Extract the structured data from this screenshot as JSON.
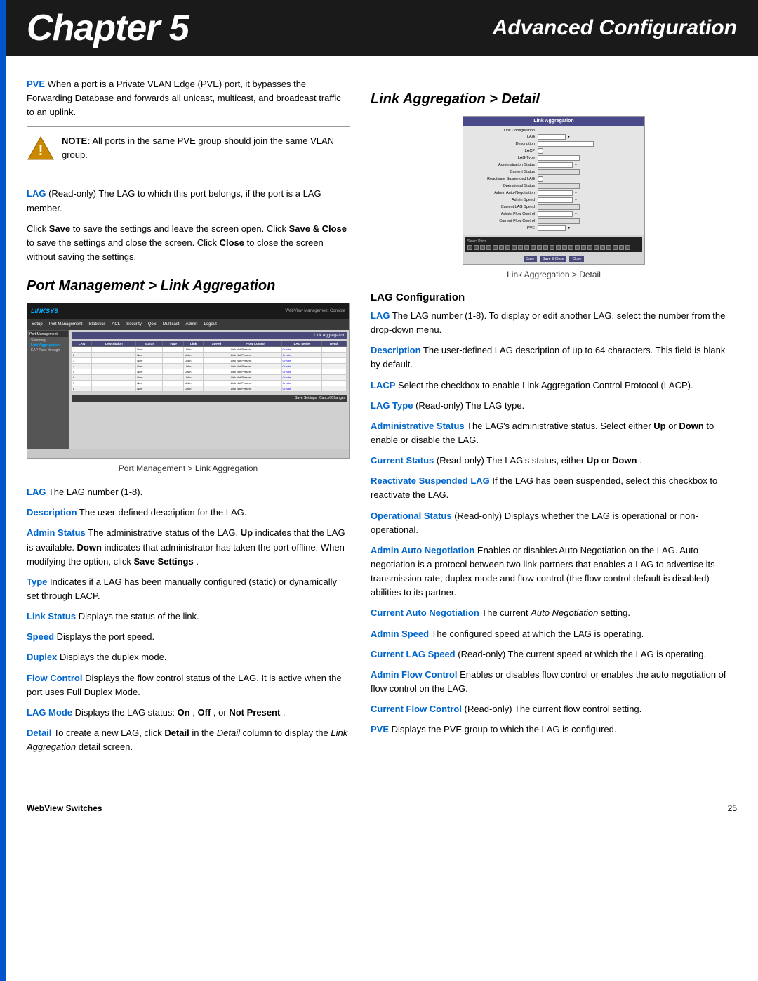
{
  "header": {
    "chapter_label": "Chapter 5",
    "advanced_config": "Advanced Configuration"
  },
  "left_column": {
    "pve_paragraph": "When a port is a Private VLAN Edge (PVE) port, it bypasses the Forwarding Database and forwards all unicast, multicast, and broadcast traffic to an uplink.",
    "pve_term": "PVE",
    "note_label": "NOTE:",
    "note_text": "All ports in the same PVE group should join the same VLAN group.",
    "lag_paragraph": "(Read-only) The LAG to which this port belongs, if the port is a LAG member.",
    "lag_term": "LAG",
    "save_instructions": "Click Save to save the settings and leave the screen open. Click Save & Close to save the settings and close the screen. Click Close to close the screen without saving the settings.",
    "port_mgmt_heading": "Port Management > Link Aggregation",
    "screenshot_caption": "Port Management > Link Aggregation",
    "lag_number": "The LAG number (1-8).",
    "lag_number_term": "LAG",
    "description_term": "Description",
    "description_text": "The user-defined description for the LAG.",
    "admin_status_term": "Admin Status",
    "admin_status_text": "The administrative status of the LAG. Up indicates that the LAG is available. Down indicates that administrator has taken the port offline. When modifying the option, click Save Settings.",
    "up_term": "Up",
    "down_term": "Down",
    "save_settings_term": "Save Settings",
    "type_term": "Type",
    "type_text": "Indicates if a LAG has been manually configured (static) or dynamically set through LACP.",
    "link_status_term": "Link Status",
    "link_status_text": "Displays the status of the link.",
    "speed_term": "Speed",
    "speed_text": "Displays the port speed.",
    "duplex_term": "Duplex",
    "duplex_text": "Displays the duplex mode.",
    "flow_control_term": "Flow Control",
    "flow_control_text": "Displays the flow control status of the LAG. It is active when the port uses Full Duplex Mode.",
    "lag_mode_term": "LAG Mode",
    "lag_mode_text": "Displays the LAG status: On, Off, or Not Present.",
    "on_term": "On",
    "off_term": "Off",
    "not_present_term": "Not Present",
    "detail_term": "Detail",
    "detail_text": "To create a new LAG, click Detail in the Detail column to display the Link Aggregation detail screen.",
    "detail_italic": "Detail",
    "link_aggregation_italic": "Link Aggregation"
  },
  "right_column": {
    "link_agg_heading": "Link Aggregation > Detail",
    "screenshot_caption": "Link Aggregation > Detail",
    "lag_config_heading": "LAG Configuration",
    "lag_config_term": "LAG",
    "lag_config_text": "The LAG number (1-8). To display or edit another LAG, select the number from the drop-down menu.",
    "lag_number_range": "(1-8)",
    "description_term": "Description",
    "description_text": "The user-defined LAG description of up to 64 characters. This field is blank by default.",
    "lacp_term": "LACP",
    "lacp_text": "Select the checkbox to enable Link Aggregation Control Protocol (LACP).",
    "lacp_full": "Link Aggregation Control Protocol (LACP)",
    "lag_type_term": "LAG Type",
    "lag_type_text": "(Read-only) The LAG type.",
    "admin_status_term": "Administrative Status",
    "admin_status_text": "The LAG's administrative status. Select either Up or Down to enable or disable the LAG.",
    "up_term": "Up",
    "down_term": "Down",
    "current_status_term": "Current Status",
    "current_status_text": "(Read-only) The LAG's status, either Up or Down.",
    "up2_term": "Up",
    "down2_term": "Down",
    "reactivate_term": "Reactivate Suspended LAG",
    "reactivate_text": "If the LAG has been suspended, select this checkbox to reactivate the LAG.",
    "operational_term": "Operational Status",
    "operational_text": "(Read-only) Displays whether the LAG is operational or non-operational.",
    "admin_auto_term": "Admin Auto Negotiation",
    "admin_auto_text": "Enables or disables Auto Negotiation on the LAG. Auto-negotiation is a protocol between two link partners that enables a LAG to advertise its transmission rate, duplex mode and flow control (the flow control default is disabled) abilities to its partner.",
    "current_auto_term": "Current Auto Negotiation",
    "current_auto_text": "The current Auto Negotiation setting.",
    "auto_neg_italic": "Auto Negotiation",
    "admin_speed_term": "Admin Speed",
    "admin_speed_text": "The configured speed at which the LAG is operating.",
    "current_lag_speed_term": "Current LAG Speed",
    "current_lag_speed_text": "(Read-only) The current speed at which the LAG is operating.",
    "admin_flow_term": "Admin Flow Control",
    "admin_flow_text": "Enables or disables flow control or enables the auto negotiation of flow control on the LAG.",
    "current_flow_term": "Current Flow Control",
    "current_flow_text": "(Read-only) The current flow control setting.",
    "pve_term": "PVE",
    "pve_text": "Displays the PVE group to which the LAG is configured."
  },
  "footer": {
    "product": "WebView Switches",
    "page_number": "25"
  },
  "mock_table": {
    "headers": [
      "LAG",
      "Description",
      "Status",
      "Type",
      "Link",
      "Speed",
      "Flow Control",
      "LAG Mode",
      "Detail"
    ],
    "rows": [
      [
        "1",
        "",
        "New",
        "",
        "Unknown",
        "",
        "Link Not Present",
        "Create"
      ],
      [
        "2",
        "",
        "New",
        "",
        "Unknown",
        "",
        "Link Not Present",
        "Create"
      ],
      [
        "3",
        "",
        "New",
        "",
        "Unknown",
        "",
        "Link Not Present",
        "Create"
      ],
      [
        "4",
        "",
        "New",
        "",
        "Unknown",
        "",
        "Link Not Present",
        "Create"
      ],
      [
        "5",
        "",
        "New",
        "",
        "Unknown",
        "",
        "Link Not Present",
        "Create"
      ],
      [
        "6",
        "",
        "New",
        "",
        "Unknown",
        "",
        "Link Not Present",
        "Create"
      ],
      [
        "7",
        "",
        "New",
        "",
        "Unknown",
        "",
        "Link Not Present",
        "Create"
      ],
      [
        "8",
        "",
        "New",
        "",
        "Unknown",
        "",
        "Link Not Present",
        "Create"
      ]
    ]
  },
  "mock_form_fields": [
    {
      "label": "Link Configuration",
      "value": ""
    },
    {
      "label": "LAG",
      "value": "1"
    },
    {
      "label": "Description",
      "value": ""
    },
    {
      "label": "LACP",
      "value": ""
    },
    {
      "label": "LAG Type",
      "value": ""
    },
    {
      "label": "Administration Status",
      "value": ""
    },
    {
      "label": "Current Status",
      "value": ""
    },
    {
      "label": "Reactivate Suspended LAG",
      "value": ""
    },
    {
      "label": "Operational Status",
      "value": ""
    },
    {
      "label": "Admin Auto-Negotiation",
      "value": ""
    },
    {
      "label": "Admin Speed",
      "value": ""
    },
    {
      "label": "Current LAG Speed",
      "value": ""
    },
    {
      "label": "Admin Flow Control",
      "value": ""
    },
    {
      "label": "Current Flow Control",
      "value": ""
    },
    {
      "label": "PVE",
      "value": ""
    }
  ]
}
